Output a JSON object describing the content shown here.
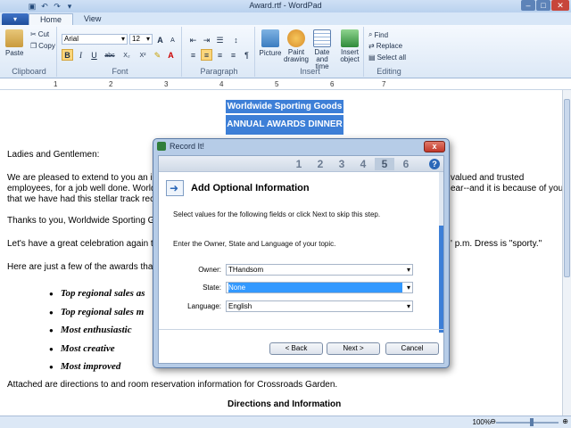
{
  "window": {
    "title": "Award.rtf - WordPad",
    "controls": {
      "minimize": "–",
      "maximize": "□",
      "close": "✕"
    }
  },
  "app_button": "▾",
  "tabs": [
    {
      "label": "Home",
      "active": true
    },
    {
      "label": "View",
      "active": false
    }
  ],
  "ribbon": {
    "clipboard": {
      "label": "Clipboard",
      "paste": "Paste",
      "cut": "Cut",
      "copy": "Copy"
    },
    "font": {
      "label": "Font",
      "family": "Arial",
      "size": "12",
      "grow": "A",
      "shrink": "A",
      "bold": "B",
      "italic": "I",
      "underline": "U",
      "strike": "abc",
      "sub": "X₂",
      "sup": "X²"
    },
    "paragraph": {
      "label": "Paragraph"
    },
    "insert": {
      "label": "Insert",
      "picture": "Picture",
      "paint": "Paint drawing",
      "datetime": "Date and time",
      "object": "Insert object"
    },
    "editing": {
      "label": "Editing",
      "find": "Find",
      "replace": "Replace",
      "select_all": "Select all"
    }
  },
  "ruler": {
    "marks": [
      "1",
      "2",
      "3",
      "4",
      "5",
      "6",
      "7"
    ]
  },
  "document": {
    "heading1": "Worldwide Sporting Goods",
    "heading2": "ANNUAL AWARDS DINNER",
    "salutation": "Ladies and Gentlemen:",
    "para1_line1": "We are pleased to extend to you an in",
    "para1_line1_end": "valued and trusted",
    "para1_line2": "employees, for a job well done.  World",
    "para1_line2_end": "ear--and it is because of you",
    "para1_line3": "that we have had this stellar track reco",
    "para2": "Thanks to you, Worldwide Sporting Go",
    "para3": "Let's have a great celebration again th",
    "para3_end": "' p.m. Dress is \"sporty.\"",
    "para4": "Here are just a few of the awards that ",
    "awards": [
      "Top regional sales as",
      "Top regional sales m",
      "Most enthusiastic",
      "Most creative",
      "Most improved"
    ],
    "attached": "Attached are directions to and room reservation information for Crossroads Garden.",
    "directions": "Directions and Information"
  },
  "status": {
    "zoom": "100%",
    "zoom_minus": "⊖",
    "zoom_plus": "⊕"
  },
  "dialog": {
    "title": "Record It!",
    "steps": [
      "1",
      "2",
      "3",
      "4",
      "5",
      "6"
    ],
    "current_step": 5,
    "heading": "Add Optional Information",
    "instruction": "Select values for the following fields or click Next to skip this step.",
    "prompt": "Enter the Owner, State and Language of your topic.",
    "fields": [
      {
        "label": "Owner:",
        "value": "THandsom"
      },
      {
        "label": "State:",
        "value": "None"
      },
      {
        "label": "Language:",
        "value": "English"
      }
    ],
    "buttons": {
      "back": "< Back",
      "next": "Next >",
      "cancel": "Cancel"
    },
    "help": "?",
    "close": "x"
  }
}
